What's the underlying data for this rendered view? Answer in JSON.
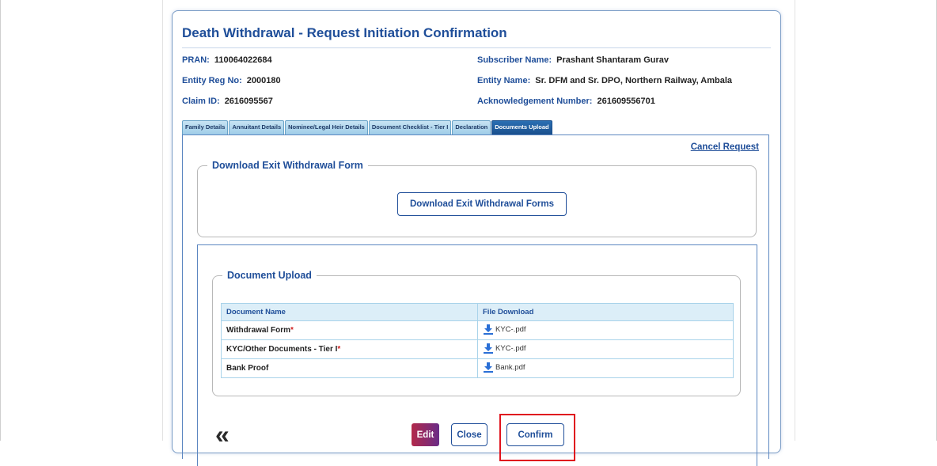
{
  "page": {
    "title": "Death Withdrawal - Request Initiation Confirmation"
  },
  "info": {
    "pran_label": "PRAN:",
    "pran_value": "110064022684",
    "subscriber_label": "Subscriber Name:",
    "subscriber_value": "Prashant Shantaram Gurav",
    "entity_reg_label": "Entity Reg No:",
    "entity_reg_value": "2000180",
    "entity_name_label": "Entity Name:",
    "entity_name_value": "Sr. DFM and Sr. DPO, Northern Railway, Ambala",
    "claim_label": "Claim ID:",
    "claim_value": "2616095567",
    "ack_label": "Acknowledgement Number:",
    "ack_value": "261609556701"
  },
  "tabs": [
    {
      "label": "Family Details",
      "active": false
    },
    {
      "label": "Annuitant Details",
      "active": false
    },
    {
      "label": "Nominee/Legal Heir Details",
      "active": false
    },
    {
      "label": "Document Checklist - Tier I",
      "active": false
    },
    {
      "label": "Declaration",
      "active": false
    },
    {
      "label": "Documents Upload",
      "active": true
    }
  ],
  "cancel_request": "Cancel Request",
  "download_section": {
    "legend": "Download Exit Withdrawal Form",
    "button_label": "Download Exit Withdrawal Forms"
  },
  "upload_section": {
    "legend": "Document Upload",
    "columns": [
      "Document Name",
      "File Download"
    ],
    "rows": [
      {
        "name": "Withdrawal Form",
        "required": "*",
        "file": "KYC-.pdf"
      },
      {
        "name": "KYC/Other Documents - Tier I",
        "required": "*",
        "file": "KYC-.pdf"
      },
      {
        "name": "Bank Proof",
        "required": "",
        "file": "Bank.pdf"
      }
    ]
  },
  "actions": {
    "back_icon": "«",
    "edit_label": "Edit",
    "close_label": "Close",
    "confirm_label": "Confirm"
  },
  "colors": {
    "accent": "#1f4e99",
    "highlight": "#e0141e",
    "download_icon": "#2a6fd6"
  }
}
